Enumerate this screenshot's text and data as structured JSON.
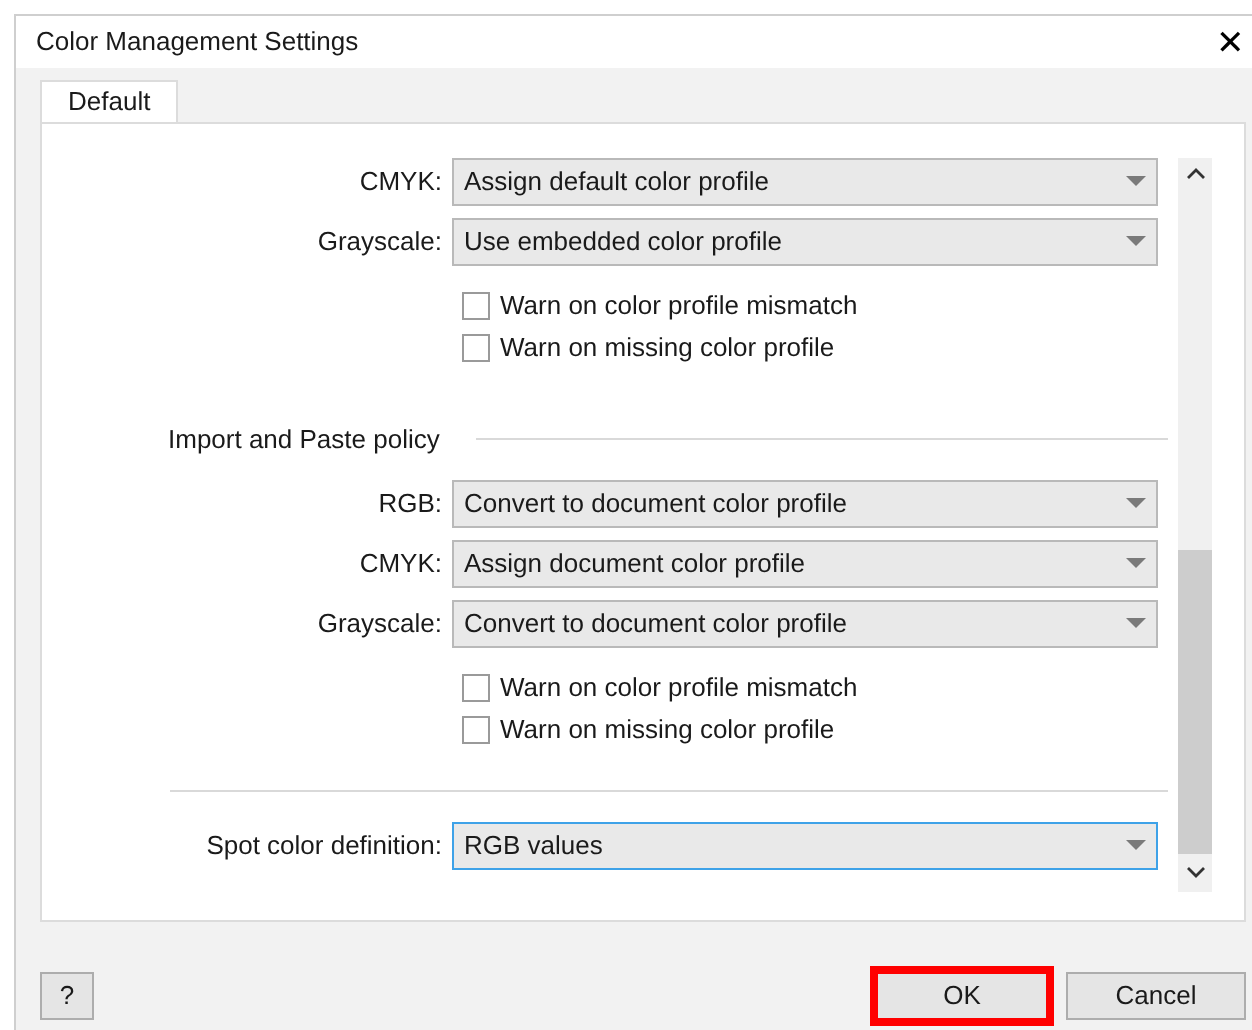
{
  "window": {
    "title": "Color Management Settings",
    "close": "✕"
  },
  "tabs": [
    {
      "label": "Default",
      "selected": true
    }
  ],
  "items": [
    {
      "kind": "dropdown",
      "label": "CMYK:",
      "value": "Assign default color profile",
      "focused": false
    },
    {
      "kind": "dropdown",
      "label": "Grayscale:",
      "value": "Use embedded color profile",
      "focused": false
    },
    {
      "kind": "checkbox",
      "label": "Warn on color profile mismatch",
      "checked": false
    },
    {
      "kind": "checkbox",
      "label": "Warn on missing color profile",
      "checked": false
    },
    {
      "kind": "heading",
      "label": "Import and Paste policy"
    },
    {
      "kind": "dropdown",
      "label": "RGB:",
      "value": "Convert to document color profile",
      "focused": false
    },
    {
      "kind": "dropdown",
      "label": "CMYK:",
      "value": "Assign document color profile",
      "focused": false
    },
    {
      "kind": "dropdown",
      "label": "Grayscale:",
      "value": "Convert to document color profile",
      "focused": false
    },
    {
      "kind": "checkbox",
      "label": "Warn on color profile mismatch",
      "checked": false
    },
    {
      "kind": "checkbox",
      "label": "Warn on missing color profile",
      "checked": false
    },
    {
      "kind": "divider"
    },
    {
      "kind": "dropdown",
      "label": "Spot color definition:",
      "value": "RGB values",
      "focused": true
    }
  ],
  "buttons": [
    {
      "label": "?",
      "highlighted": false
    },
    {
      "label": "OK",
      "highlighted": true
    },
    {
      "label": "Cancel",
      "highlighted": false
    }
  ]
}
